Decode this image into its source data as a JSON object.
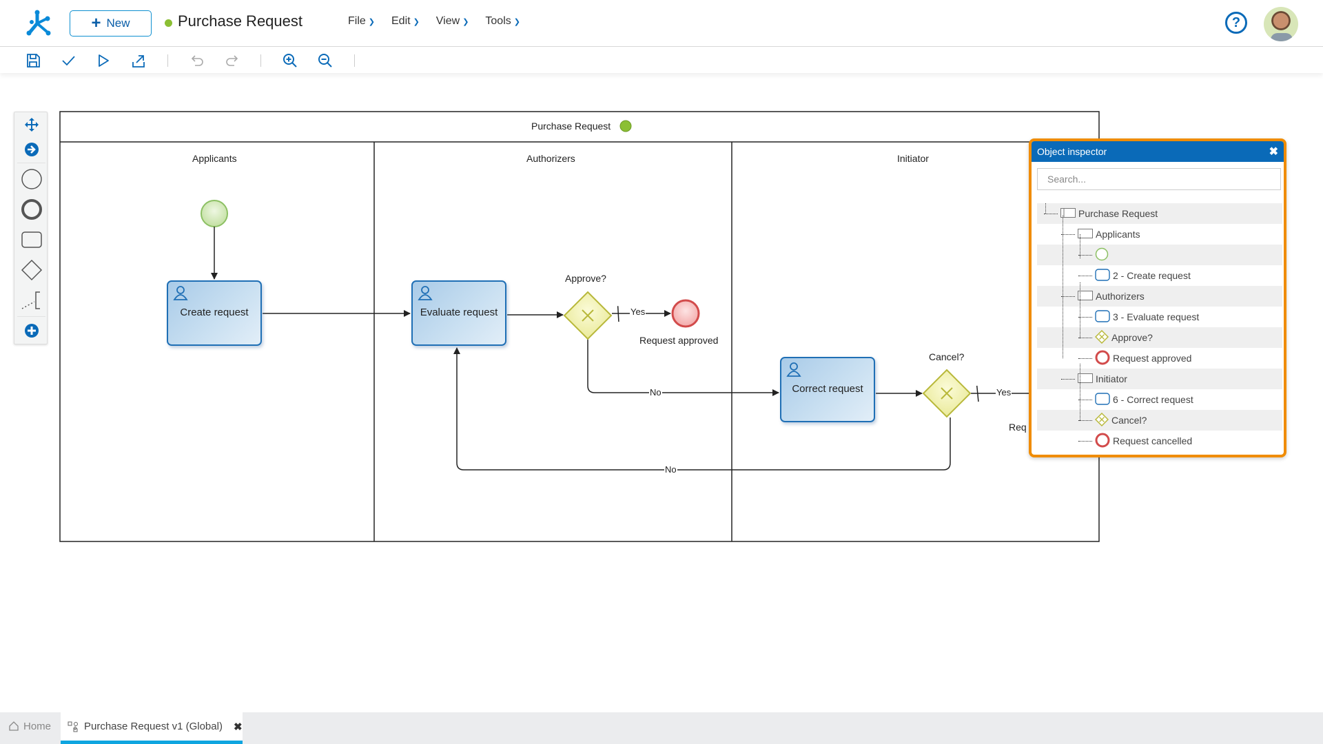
{
  "app": {
    "new_button": "New",
    "title": "Purchase Request",
    "title_status_color": "#8bbf34",
    "menu": [
      {
        "label": "File"
      },
      {
        "label": "Edit"
      },
      {
        "label": "View"
      },
      {
        "label": "Tools"
      }
    ],
    "help_icon": "?",
    "avatar_icon": "user-avatar"
  },
  "toolbar": {
    "buttons": [
      "save",
      "validate",
      "run",
      "export",
      "undo",
      "redo",
      "zoom-in",
      "zoom-out"
    ]
  },
  "palette": {
    "items": [
      "move-tool",
      "connect-tool",
      "start-event",
      "end-event",
      "task",
      "gateway",
      "annotation",
      "more"
    ]
  },
  "diagram": {
    "pool_name": "Purchase Request",
    "pool_status_color": "#8bbf34",
    "lanes": [
      {
        "name": "Applicants"
      },
      {
        "name": "Authorizers"
      },
      {
        "name": "Initiator"
      }
    ],
    "tasks": [
      {
        "label": "Create request"
      },
      {
        "label": "Evaluate request"
      },
      {
        "label": "Correct request"
      }
    ],
    "gateways": [
      {
        "label": "Approve?"
      },
      {
        "label": "Cancel?"
      }
    ],
    "end_events": [
      {
        "label": "Request approved"
      },
      {
        "label": "Req"
      }
    ],
    "flow_labels": {
      "approve_yes": "Yes",
      "approve_no": "No",
      "cancel_yes": "Yes",
      "cancel_no": "No"
    }
  },
  "inspector": {
    "title": "Object inspector",
    "close": "✖",
    "search_placeholder": "Search...",
    "tree": [
      {
        "label": "Purchase Request",
        "type": "pool",
        "level": 0
      },
      {
        "label": "Applicants",
        "type": "lane",
        "level": 1
      },
      {
        "label": "",
        "type": "start",
        "level": 2
      },
      {
        "label": "2 - Create request",
        "type": "task",
        "level": 2
      },
      {
        "label": "Authorizers",
        "type": "lane",
        "level": 1
      },
      {
        "label": "3 - Evaluate request",
        "type": "task",
        "level": 2
      },
      {
        "label": "Approve?",
        "type": "gateway",
        "level": 2
      },
      {
        "label": "Request approved",
        "type": "end",
        "level": 2
      },
      {
        "label": "Initiator",
        "type": "lane",
        "level": 1
      },
      {
        "label": "6 - Correct request",
        "type": "task",
        "level": 2
      },
      {
        "label": "Cancel?",
        "type": "gateway",
        "level": 2
      },
      {
        "label": "Request cancelled",
        "type": "end",
        "level": 2
      }
    ]
  },
  "tabs": {
    "home": "Home",
    "active": "Purchase Request v1 (Global)",
    "close": "✖"
  },
  "colors": {
    "accent": "#0a6ab8",
    "inspector_border": "#f08c00",
    "tab_underline": "#0ea5e0",
    "task_border": "#1f6fb5",
    "gateway": "#b8b83a",
    "end_event": "#d24b4b",
    "start_event": "#8cc063"
  }
}
